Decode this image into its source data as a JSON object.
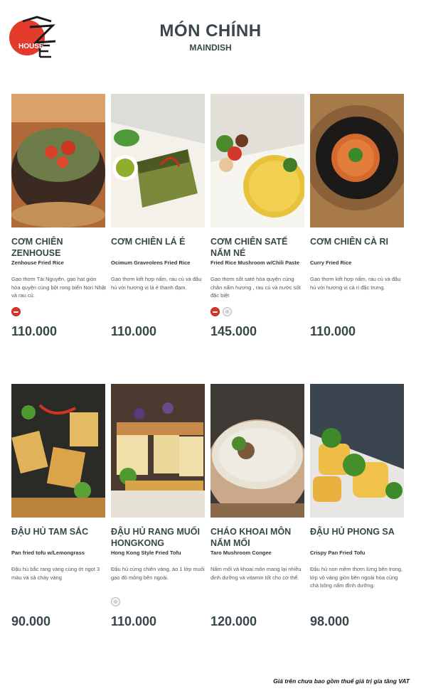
{
  "brand": {
    "logo_text": "HOUSE"
  },
  "header": {
    "title": "MÓN CHÍNH",
    "subtitle": "MAINDISH"
  },
  "items": [
    {
      "name": "CƠM CHIÊN ZENHOUSE",
      "en": "Zenhouse Fried Rice",
      "desc": "Gạo thơm Tài Nguyên, gạo hạt giòn hòa quyện cùng bột rong biển Nori Nhật và rau củ.",
      "badges": [
        "spicy-badge-icon"
      ],
      "price": "110.000"
    },
    {
      "name": "CƠM CHIÊN LÁ É",
      "en": "Ocimum Graveolens Fried Rice",
      "desc": "Gạo thơm kết hợp nấm, rau củ và đậu hủ với hương vị lá é thanh đạm.",
      "badges": [],
      "price": "110.000"
    },
    {
      "name": "CƠM CHIÊN SATẾ NẤM NÉ",
      "en": "Fried Rice Mushroom w/Chili Paste",
      "desc": "Gạo thơm sốt saté hòa quyện cùng chân nấm hương , rau củ và nước sốt đặc biệt",
      "badges": [
        "spicy-badge-icon",
        "vegetarian-badge-icon"
      ],
      "price": "145.000"
    },
    {
      "name": "CƠM CHIÊN CÀ RI",
      "en": "Curry Fried Rice",
      "desc": "Gạo thơm kết hợp nấm, rau củ và đậu hủ với hương vị cà ri đặc trưng.",
      "badges": [],
      "price": "110.000"
    },
    {
      "name": "ĐẬU HỦ TAM SẮC",
      "en": "Pan fried tofu w/Lemongrass",
      "desc": "Đậu hủ bắc rang vàng cùng ớt ngọt 3 màu và sả cháy vàng",
      "badges": [],
      "price": "90.000"
    },
    {
      "name": "ĐẬU HỦ RANG MUỐI HONGKONG",
      "en": "Hong Kong Style Fried Tofu",
      "desc": "Đậu hủ cừng chiên vàng, áo 1 lớp muối gạo đỏ mông bên ngoài.",
      "badges": [
        "vegetarian-badge-icon"
      ],
      "price": "110.000"
    },
    {
      "name": "CHÁO KHOAI MÔN NẤM MỐI",
      "en": "Taro Mushroom Congee",
      "desc": "Nấm mối và khoai môn mang lại nhiều dinh dưỡng và vitamin tốt cho cơ thể.",
      "badges": [],
      "price": "120.000"
    },
    {
      "name": "ĐẬU HỦ PHONG SA",
      "en": "Crispy Pan Fried Tofu",
      "desc": "Đậu hủ non mềm thơm lừng bên trong, lớp vỏ vàng giòn bên ngoài hòa cùng chà bông nấm đình dưỡng.",
      "badges": [],
      "price": "98.000"
    }
  ],
  "footnote": "Giá trên chưa bao gồm thuế giá trị gia tăng VAT"
}
